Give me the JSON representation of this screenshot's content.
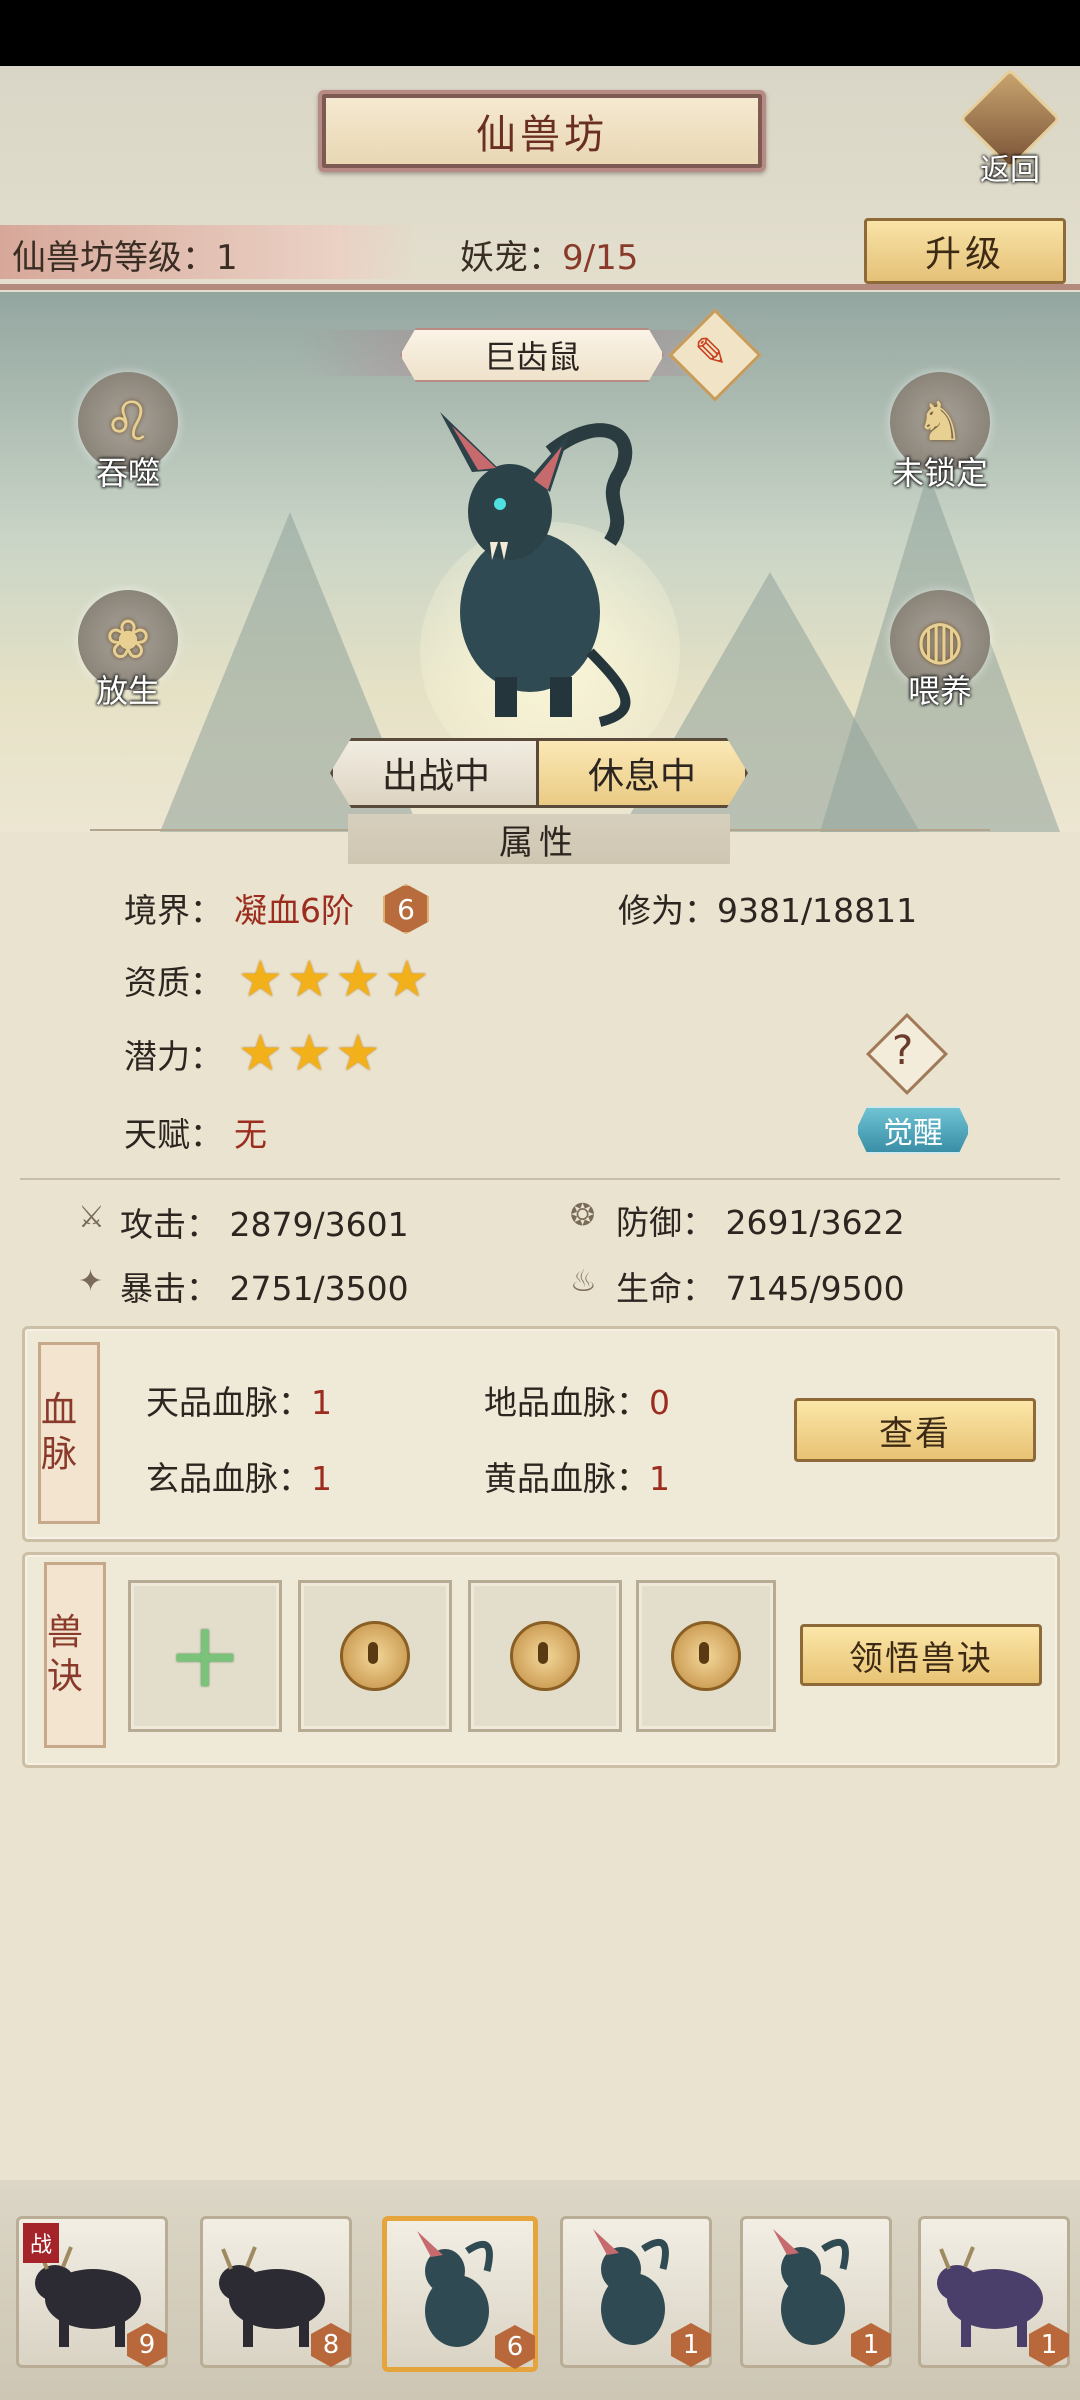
{
  "header": {
    "title": "仙兽坊",
    "back_label": "返回",
    "level_label": "仙兽坊等级：",
    "level_value": "1",
    "pet_label": "妖宠：",
    "pet_value": "9/15",
    "upgrade_label": "升级"
  },
  "pet": {
    "name": "巨齿鼠",
    "actions": {
      "devour": "吞噬",
      "release": "放生",
      "lock": "未锁定",
      "feed": "喂养"
    },
    "tabs": [
      "出战中",
      "休息中"
    ],
    "active_tab": 1
  },
  "attributes": {
    "section_title": "属性",
    "realm_label": "境界：",
    "realm_value": "凝血6阶",
    "realm_badge": "6",
    "cultivation_label": "修为：",
    "cultivation_value": "9381/18811",
    "aptitude_label": "资质：",
    "aptitude_stars": 4,
    "potential_label": "潜力：",
    "potential_stars": 3,
    "talent_label": "天赋：",
    "talent_value": "无",
    "awaken_label": "觉醒",
    "attack_label": "攻击：",
    "attack_value": "2879/3601",
    "defense_label": "防御：",
    "defense_value": "2691/3622",
    "crit_label": "暴击：",
    "crit_value": "2751/3500",
    "hp_label": "生命：",
    "hp_value": "7145/9500"
  },
  "bloodline": {
    "tag": "血脉",
    "heaven_label": "天品血脉：",
    "heaven_value": "1",
    "earth_label": "地品血脉：",
    "earth_value": "0",
    "mystic_label": "玄品血脉：",
    "mystic_value": "1",
    "yellow_label": "黄品血脉：",
    "yellow_value": "1",
    "view_label": "查看"
  },
  "skills": {
    "tag": "兽诀",
    "learn_label": "领悟兽诀"
  },
  "roster": {
    "battle_tag": "战",
    "levels": [
      "9",
      "8",
      "6",
      "1",
      "1",
      "1"
    ],
    "selected_index": 2
  },
  "colors": {
    "accent_red": "#9c2d1e",
    "gold": "#e8c374",
    "star": "#f2b11a"
  }
}
